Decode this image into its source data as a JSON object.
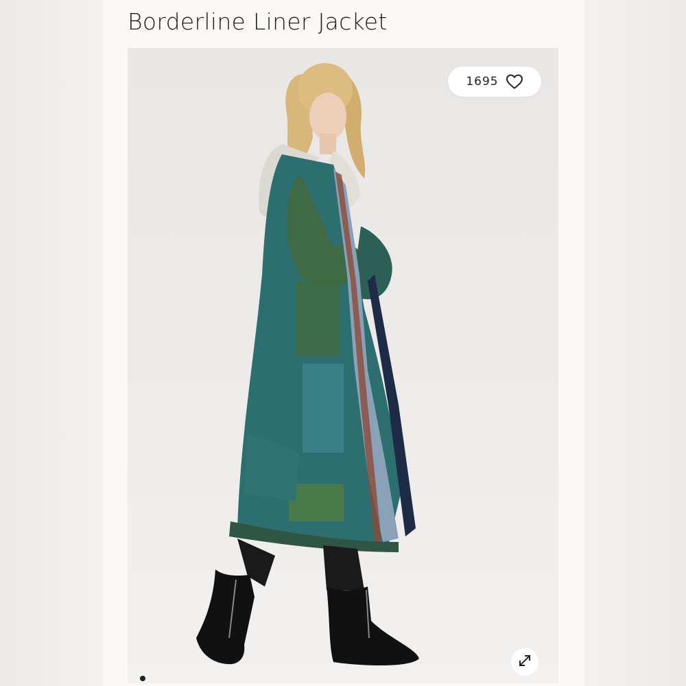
{
  "product": {
    "title": "Borderline Liner Jacket",
    "like_count": "1695"
  },
  "icons": {
    "like": "heart-outline-icon",
    "expand": "expand-arrows-icon"
  },
  "gallery": {
    "dots": 1,
    "active_dot": 1
  },
  "colors": {
    "page_bg": "#f3f1ef",
    "card_bg": "#fbf8f6",
    "photo_bg": "#ebe9e7",
    "text": "#1e1e1e",
    "coat_teal": "#2d6f70",
    "coat_green": "#3f6a44"
  }
}
